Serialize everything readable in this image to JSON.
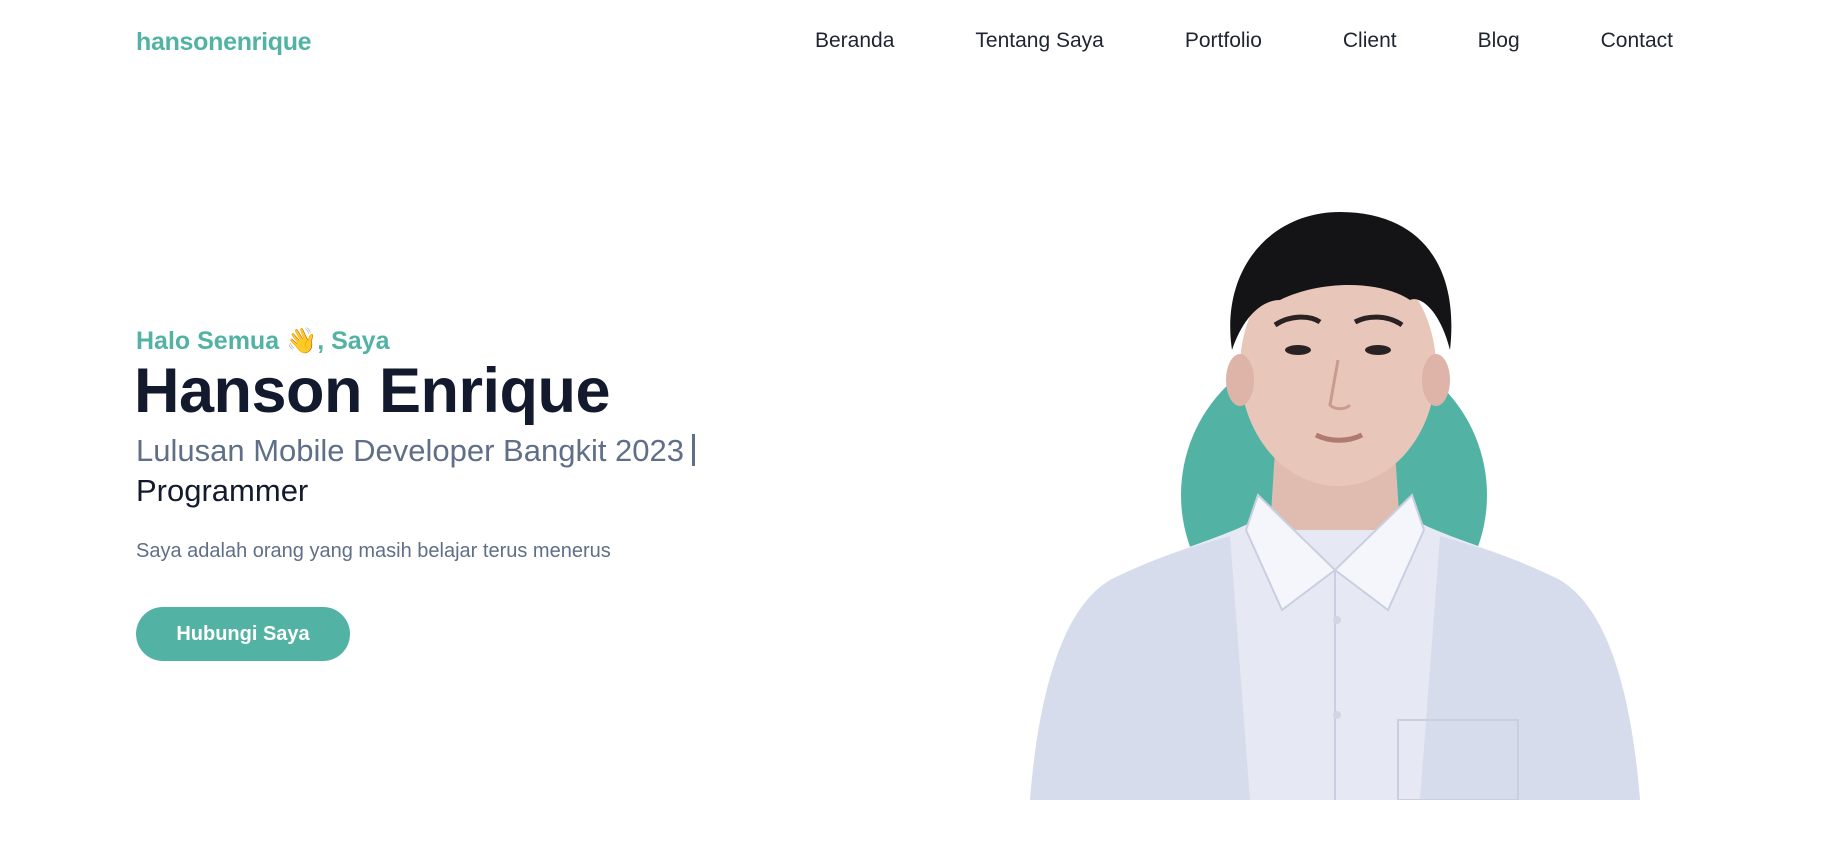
{
  "header": {
    "logo": "hansonenrique",
    "nav": [
      "Beranda",
      "Tentang Saya",
      "Portfolio",
      "Client",
      "Blog",
      "Contact"
    ]
  },
  "hero": {
    "greeting_prefix": "Halo Semua ",
    "greeting_emoji": "👋",
    "greeting_suffix": ", Saya",
    "name": "Hanson Enrique",
    "subtitle": "Lulusan Mobile Developer Bangkit 2023",
    "role": "Programmer",
    "tagline": "Saya adalah orang yang masih belajar terus menerus",
    "cta_label": "Hubungi Saya"
  },
  "colors": {
    "accent": "#52b3a4",
    "heading": "#141a2e",
    "muted": "#5f6f87"
  }
}
